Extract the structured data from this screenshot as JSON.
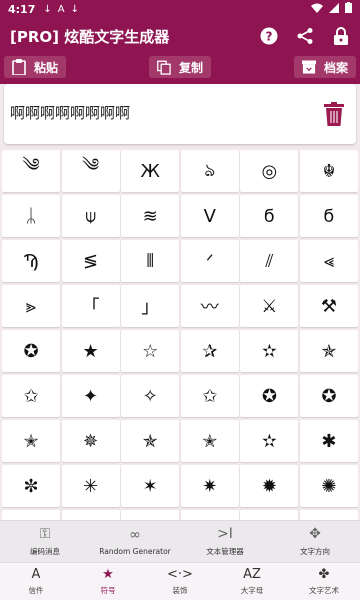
{
  "status_bar": {
    "time": "4:17",
    "left_icons": [
      "download-icon",
      "a-icon",
      "download-icon"
    ],
    "right_icons": [
      "wifi-icon",
      "signal-icon",
      "battery-icon"
    ]
  },
  "app_bar": {
    "title": "[PRO] 炫酷文字生成器",
    "actions": [
      "help-icon",
      "share-icon",
      "lock-icon"
    ]
  },
  "actions": {
    "paste": "粘贴",
    "copy": "复制",
    "archive": "档案"
  },
  "text_box": {
    "content": "啊啊啊啊啊啊啊啊"
  },
  "symbols": [
    "༄",
    "༄",
    "Ж",
    "ঌ",
    "◎",
    "☬",
    "ᛦ",
    "⍦",
    "≋",
    "ᐯ",
    "ϭ",
    "ϭ",
    "Ϡ",
    "≶",
    "⦀",
    "ᐟ",
    "⫽",
    "⪡",
    "⪢",
    "「",
    "」",
    "〰",
    "⚔",
    "⚒",
    "✪",
    "★",
    "☆",
    "✰",
    "✫",
    "✯",
    "✩",
    "✦",
    "✧",
    "✩",
    "✪",
    "✪",
    "✭",
    "✵",
    "✯",
    "✭",
    "✫",
    "✱",
    "✼",
    "✳",
    "✶",
    "✷",
    "✹",
    "✺",
    "✹",
    "✹",
    "✹",
    "✹",
    "✹",
    "✹"
  ],
  "tools": [
    {
      "icon": "key-icon",
      "glyph": "⚿",
      "label": "编码消息"
    },
    {
      "icon": "infinity-icon",
      "glyph": "∞",
      "label": "Random Generator"
    },
    {
      "icon": "cursor-icon",
      "glyph": ">I",
      "label": "文本管理器"
    },
    {
      "icon": "arrows-icon",
      "glyph": "✥",
      "label": "文字方向"
    }
  ],
  "nav": [
    {
      "icon": "text-icon",
      "glyph": "A",
      "label": "信件"
    },
    {
      "icon": "star-icon",
      "glyph": "★",
      "label": "符号"
    },
    {
      "icon": "code-icon",
      "glyph": "<·>",
      "label": "装饰"
    },
    {
      "icon": "az-icon",
      "glyph": "AZ",
      "label": "大字母"
    },
    {
      "icon": "bug-icon",
      "glyph": "✤",
      "label": "文字艺术"
    }
  ],
  "colors": {
    "primary": "#8e1552",
    "accent": "#c2185b"
  }
}
